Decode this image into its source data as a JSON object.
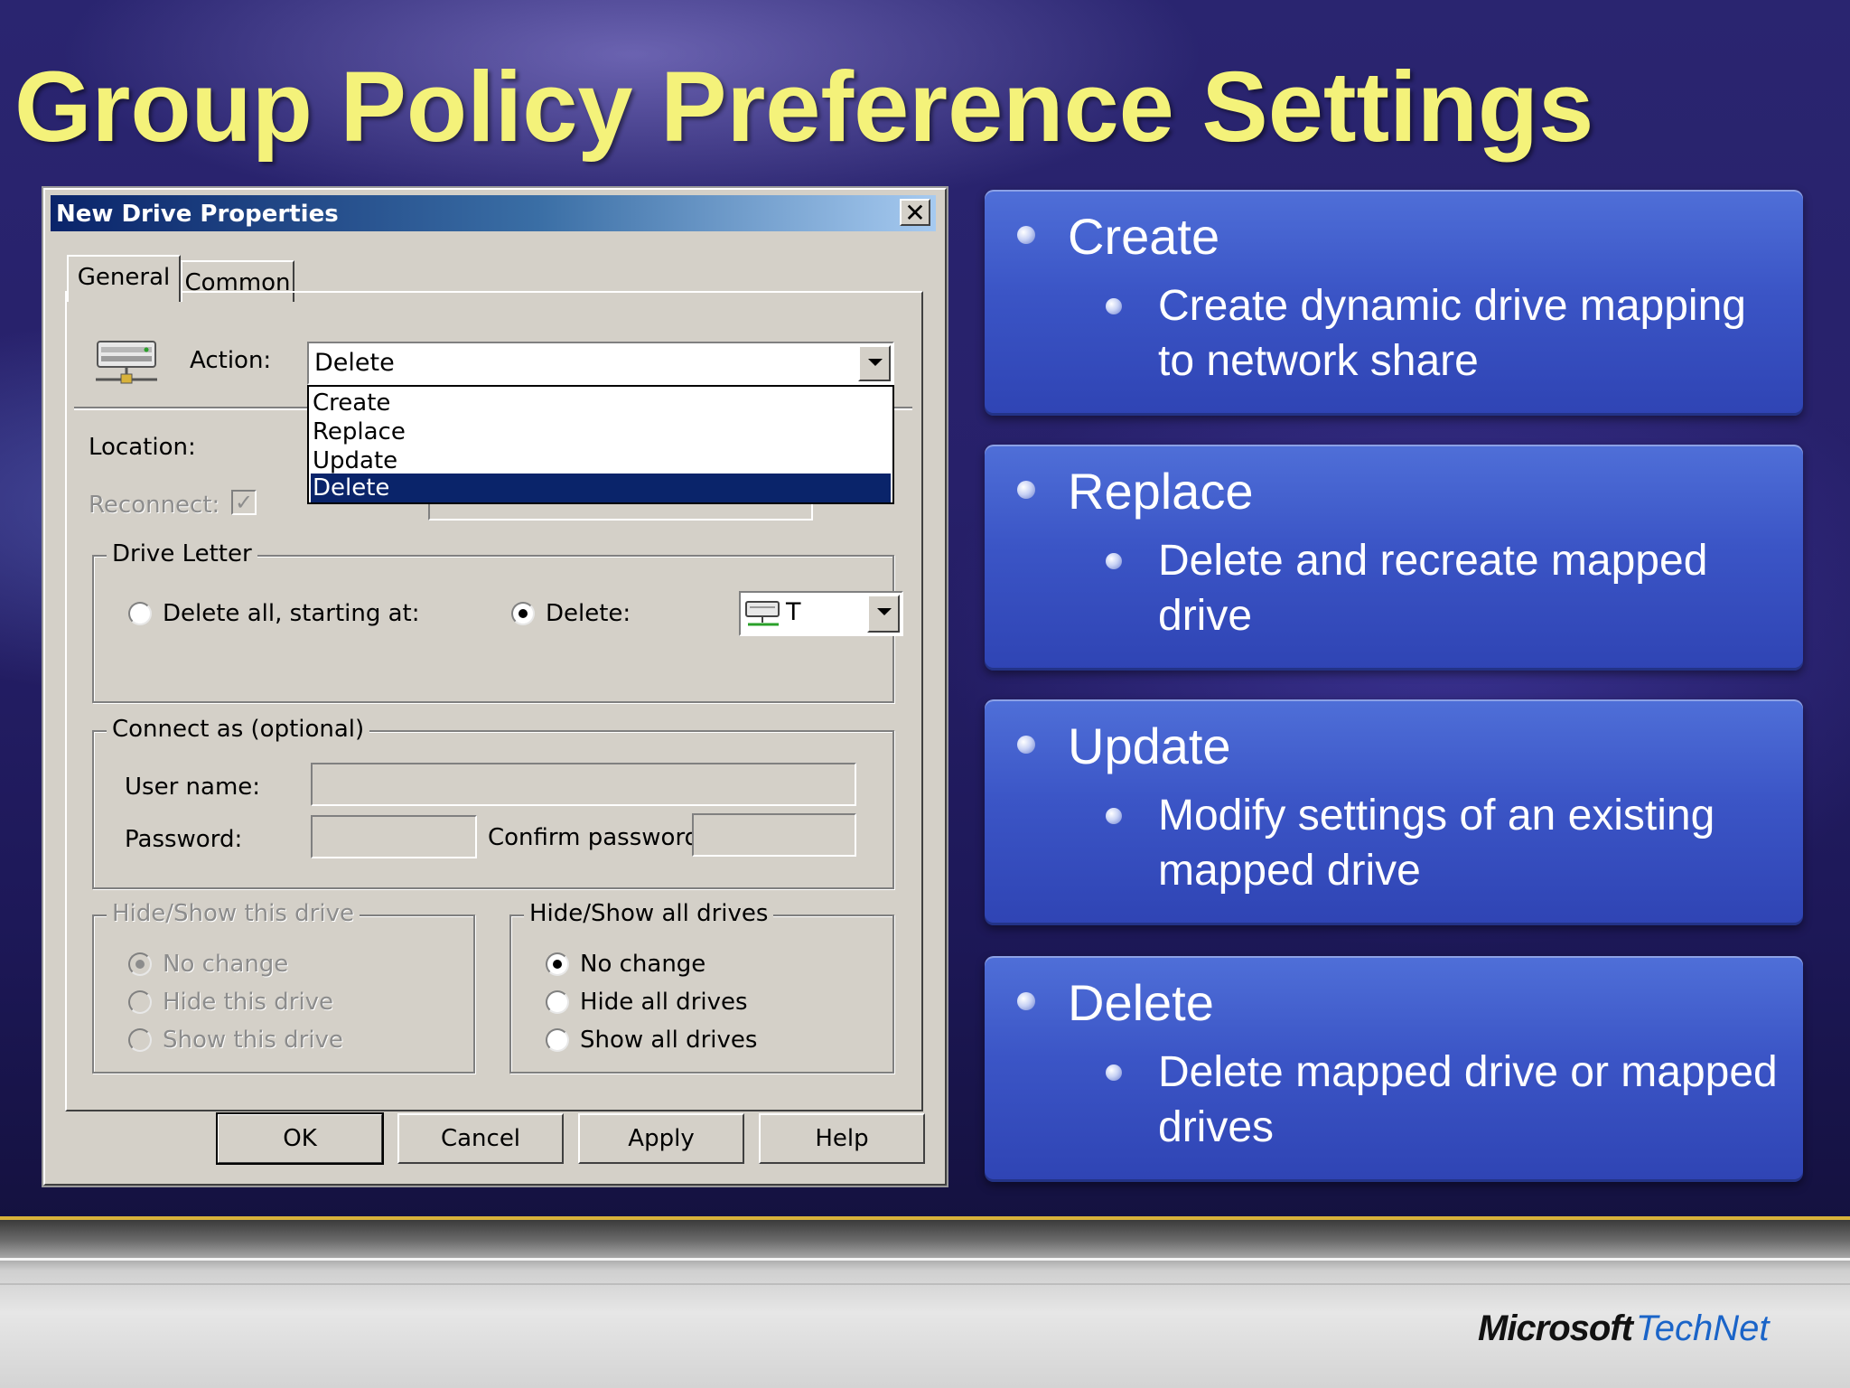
{
  "slide": {
    "title": "Group Policy Preference Settings",
    "logo": {
      "brand": "Microsoft",
      "product": "TechNet"
    }
  },
  "dialog": {
    "title": "New Drive Properties",
    "close_glyph": "✕",
    "tabs": [
      {
        "label": "General",
        "active": true
      },
      {
        "label": "Common",
        "active": false
      }
    ],
    "action_label": "Action:",
    "action_value": "Delete",
    "action_options": [
      {
        "label": "Create",
        "selected": false
      },
      {
        "label": "Replace",
        "selected": false
      },
      {
        "label": "Update",
        "selected": false
      },
      {
        "label": "Delete",
        "selected": true
      }
    ],
    "location_label": "Location:",
    "reconnect_label": "Reconnect:",
    "drive_letter": {
      "title": "Drive Letter",
      "delete_all_label": "Delete all, starting at:",
      "delete_label": "Delete:",
      "selected_letter": "T"
    },
    "connect_as": {
      "title": "Connect as (optional)",
      "user_name_label": "User name:",
      "password_label": "Password:",
      "confirm_password_label": "Confirm password:"
    },
    "hide_show_this": {
      "title": "Hide/Show this drive",
      "options": [
        "No change",
        "Hide this drive",
        "Show this drive"
      ]
    },
    "hide_show_all": {
      "title": "Hide/Show all drives",
      "options": [
        "No change",
        "Hide all drives",
        "Show all drives"
      ]
    },
    "buttons": {
      "ok": "OK",
      "cancel": "Cancel",
      "apply": "Apply",
      "help": "Help"
    }
  },
  "panels": [
    {
      "heading": "Create",
      "text": "Create dynamic drive mapping to network share"
    },
    {
      "heading": "Replace",
      "text": "Delete and recreate mapped drive"
    },
    {
      "heading": "Update",
      "text": "Modify settings of an existing mapped drive"
    },
    {
      "heading": "Delete",
      "text": "Delete mapped drive or mapped drives"
    }
  ],
  "colors": {
    "title": "#f4f27a",
    "panel": "#3b55c6",
    "selection": "#0a246a",
    "dialog_face": "#d4d0c8",
    "logo_accent": "#1a64c8"
  }
}
